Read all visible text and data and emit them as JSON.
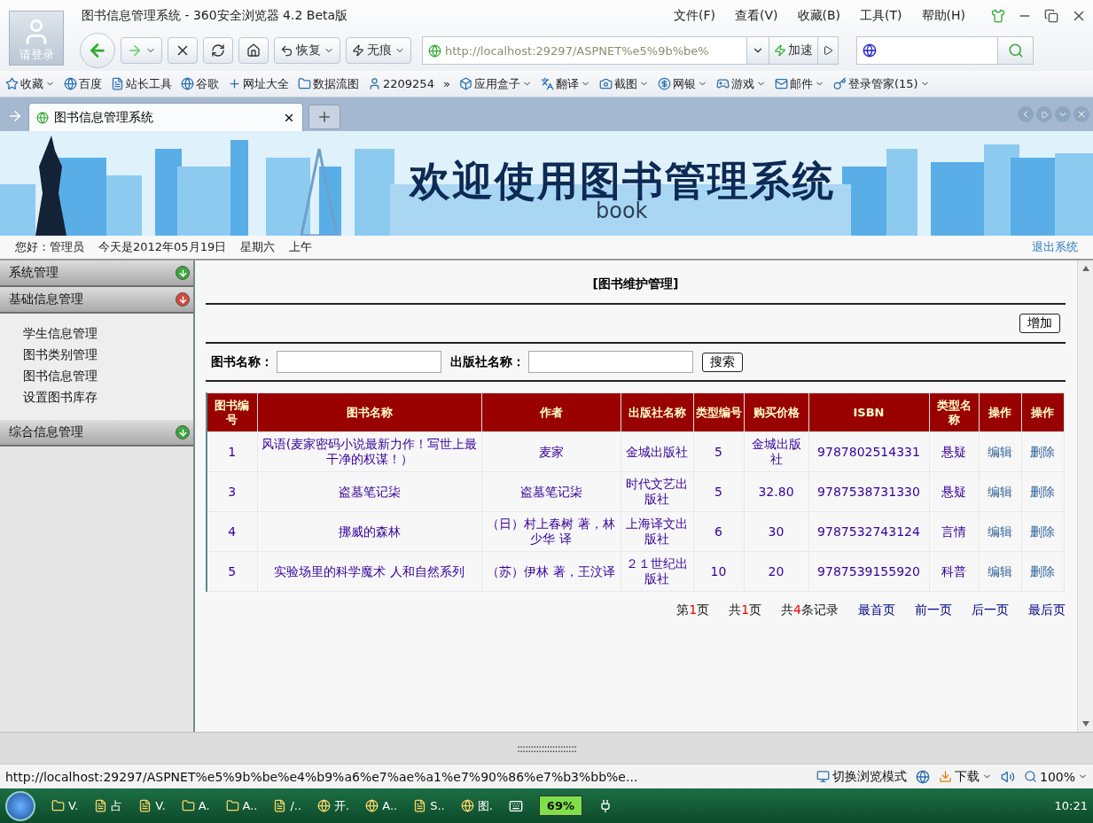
{
  "browser": {
    "title": "图书信息管理系统 - 360安全浏览器 4.2 Beta版",
    "avatar_label": "请登录",
    "menu": [
      "文件(F)",
      "查看(V)",
      "收藏(B)",
      "工具(T)",
      "帮助(H)"
    ],
    "toolbar": {
      "restore": "恢复",
      "private": "无痕",
      "address": "http://localhost:29297/ASPNET%e5%9b%be%",
      "speed": "加速"
    },
    "bookmarks": [
      {
        "label": "收藏",
        "dropdown": true
      },
      {
        "label": "百度",
        "dropdown": false
      },
      {
        "label": "站长工具",
        "dropdown": false
      },
      {
        "label": "谷歌",
        "dropdown": false
      },
      {
        "label": "网址大全",
        "dropdown": false
      },
      {
        "label": "数据流图",
        "dropdown": false
      },
      {
        "label": "2209254",
        "dropdown": false
      },
      {
        "label": "»",
        "dropdown": false
      },
      {
        "label": "应用盒子",
        "dropdown": true
      },
      {
        "label": "翻译",
        "dropdown": true
      },
      {
        "label": "截图",
        "dropdown": true
      },
      {
        "label": "网银",
        "dropdown": true
      },
      {
        "label": "游戏",
        "dropdown": true
      },
      {
        "label": "邮件",
        "dropdown": true
      },
      {
        "label": "登录管家(15)",
        "dropdown": true
      }
    ],
    "tabs": [
      {
        "label": "图书信息管理系统",
        "selected": true
      }
    ]
  },
  "banner": {
    "title": "欢迎使用图书管理系统",
    "subtitle": "book"
  },
  "userbar": {
    "greeting": "您好：管理员",
    "date": "今天是2012年05月19日",
    "weekday": "星期六",
    "period": "上午",
    "logout": "退出系统"
  },
  "sidebar": [
    {
      "label": "系统管理",
      "expanded": false
    },
    {
      "label": "基础信息管理",
      "expanded": true,
      "children": [
        "学生信息管理",
        "图书类别管理",
        "图书信息管理",
        "设置图书库存"
      ]
    },
    {
      "label": "综合信息管理",
      "expanded": false
    }
  ],
  "page": {
    "heading": "[图书维护管理]",
    "add_button": "增加",
    "search_fields": [
      "图书名称：",
      "出版社名称："
    ],
    "search_button": "搜索"
  },
  "table": {
    "columns": [
      "图书编号",
      "图书名称",
      "作者",
      "出版社名称",
      "类型编号",
      "购买价格",
      "ISBN",
      "类型名称",
      "操作",
      "操作"
    ],
    "rows": [
      [
        "1",
        "风语(麦家密码小说最新力作！写世上最干净的权谋！）",
        "麦家",
        "金城出版社",
        "5",
        "金城出版社",
        "9787802514331",
        "悬疑",
        "编辑",
        "删除"
      ],
      [
        "3",
        "盗墓笔记柒",
        "盗墓笔记柒",
        "时代文艺出版社",
        "5",
        "32.80",
        "9787538731330",
        "悬疑",
        "编辑",
        "删除"
      ],
      [
        "4",
        "挪威的森林",
        "（日）村上春树  著，林少华  译",
        "上海译文出版社",
        "6",
        "30",
        "9787532743124",
        "言情",
        "编辑",
        "删除"
      ],
      [
        "5",
        "实验场里的科学魔术  人和自然系列",
        "（苏）伊林    著，王汶译",
        "２１世纪出版社",
        "10",
        "20",
        "9787539155920",
        "科普",
        "编辑",
        "删除"
      ]
    ]
  },
  "pager": {
    "counts": [
      {
        "prefix": "第",
        "number": "1",
        "suffix": "页"
      },
      {
        "prefix": "共",
        "number": "1",
        "suffix": "页"
      },
      {
        "prefix": "共",
        "number": "4",
        "suffix": "条记录"
      }
    ],
    "links": [
      "最首页",
      "前一页",
      "后一页",
      "最后页"
    ]
  },
  "grip": "::::::::::::::::::::::",
  "status_bar": {
    "url": "http://localhost:29297/ASPNET%e5%9b%be%e4%b9%a6%e7%ae%a1%e7%90%86%e7%b3%bb%e...",
    "mode": "切换浏览模式",
    "download": "下载",
    "zoom": "100%"
  },
  "taskbar": {
    "items": [
      "V.",
      "占",
      "V.",
      "A.",
      "A..",
      "/..",
      "开.",
      "A..",
      "S..",
      "图."
    ],
    "battery": "69%",
    "clock": "10:21"
  }
}
